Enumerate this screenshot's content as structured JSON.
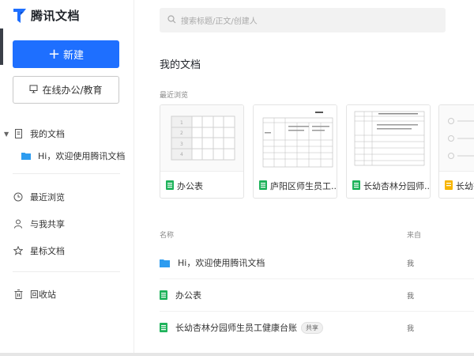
{
  "app": {
    "logo_text": "腾讯文档",
    "brand_color": "#1e6fff"
  },
  "sidebar": {
    "new_button": "新建",
    "office_button": "在线办公/教育",
    "my_docs": "我的文档",
    "welcome_doc": "Hi，欢迎使用腾讯文档",
    "recent": "最近浏览",
    "shared": "与我共享",
    "starred": "星标文档",
    "trash": "回收站"
  },
  "search": {
    "placeholder": "搜索标题/正文/创建人"
  },
  "main": {
    "title": "我的文档",
    "recent_label": "最近浏览",
    "cards": [
      {
        "name": "办公表",
        "icon": "sheet-icon"
      },
      {
        "name": "庐阳区师生员工...",
        "icon": "sheet-icon"
      },
      {
        "name": "长幼杏林分园师...",
        "icon": "sheet-icon"
      },
      {
        "name": "长幼杏",
        "icon": "form-icon"
      }
    ],
    "columns": {
      "name": "名称",
      "from": "来自"
    },
    "rows": [
      {
        "name": "Hi，欢迎使用腾讯文档",
        "from": "我",
        "icon": "folder-icon"
      },
      {
        "name": "办公表",
        "from": "我",
        "icon": "sheet-icon"
      },
      {
        "name": "长幼杏林分园师生员工健康台账",
        "from": "我",
        "icon": "sheet-icon",
        "tag": "共享"
      }
    ]
  }
}
